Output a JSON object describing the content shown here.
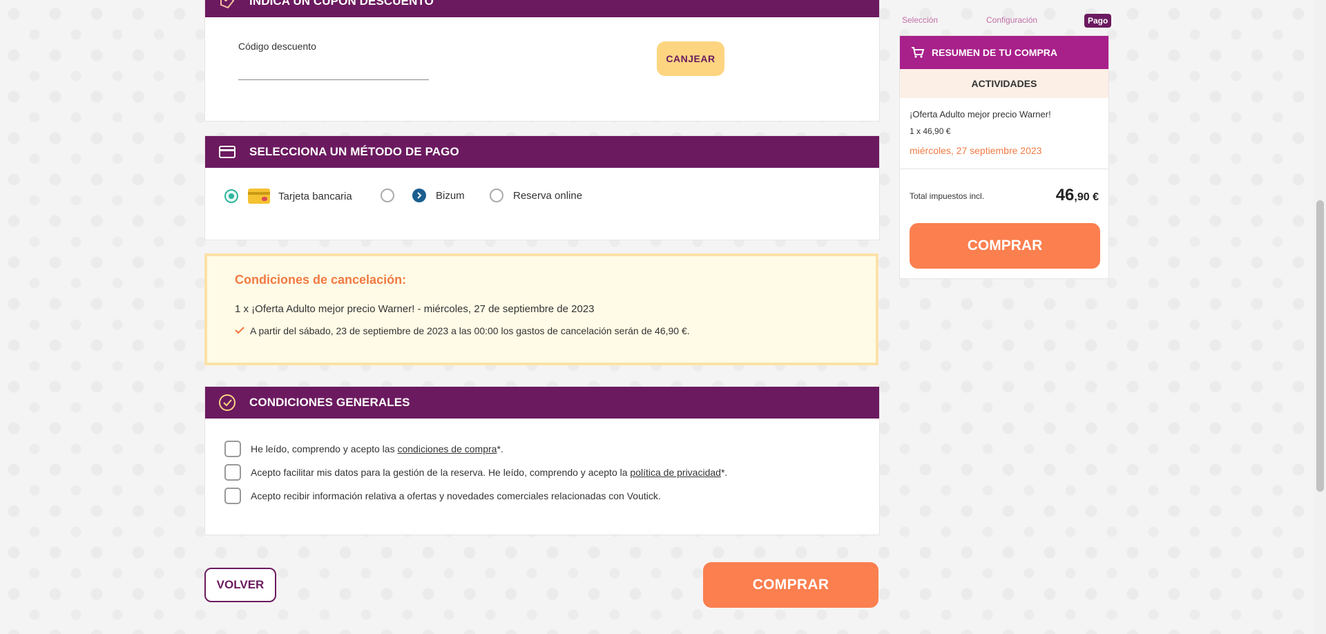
{
  "coupon": {
    "title": "INDICA UN CUPÓN DESCUENTO",
    "label": "Código descuento",
    "placeholder": "",
    "button": "CANJEAR"
  },
  "payment": {
    "title": "SELECCIONA UN MÉTODO DE PAGO",
    "options": [
      {
        "label": "Tarjeta bancaria",
        "selected": true
      },
      {
        "label": "Bizum",
        "selected": false
      },
      {
        "label": "Reserva online",
        "selected": false
      }
    ]
  },
  "cancellation": {
    "title": "Condiciones de cancelación:",
    "line1": "1 x ¡Oferta Adulto mejor precio Warner! - miércoles, 27 de septiembre de 2023",
    "line2": "A partir del sábado, 23 de septiembre de 2023 a las 00:00 los gastos de cancelación serán de 46,90 €."
  },
  "general": {
    "title": "CONDICIONES GENERALES",
    "cb1_pre": "He leído, comprendo y acepto las ",
    "cb1_link": "condiciones de compra",
    "cb1_post": "*.",
    "cb2_pre": "Acepto facilitar mis datos para la gestión de la reserva. He leído, comprendo y acepto la ",
    "cb2_link": "política de privacidad",
    "cb2_post": "*.",
    "cb3": "Acepto recibir información relativa a ofertas y novedades comerciales relacionadas con Voutick."
  },
  "actions": {
    "back": "VOLVER",
    "buy": "COMPRAR"
  },
  "steps": {
    "s1": "Selección",
    "s2": "Configuración",
    "s3": "Pago"
  },
  "summary": {
    "title": "RESUMEN DE TU COMPRA",
    "section": "ACTIVIDADES",
    "item_title": "¡Oferta Adulto mejor precio Warner!",
    "item_qty": "1 x 46,90 €",
    "item_date": "miércoles, 27 septiembre 2023",
    "total_label": "Total impuestos incl.",
    "total_int": "46",
    "total_dec": ",90 €",
    "buy": "COMPRAR"
  },
  "colors": {
    "primary": "#6b1a5f",
    "accent": "#fb7f4f",
    "summary_header": "#a8208a",
    "coupon_button": "#fdd580",
    "radio_selected": "#2fb59c"
  },
  "icons": {
    "coupon": "coupon-icon",
    "payment": "credit-card-icon",
    "general": "check-circle-icon",
    "cart": "cart-icon",
    "card": "card-icon",
    "bizum": "bizum-icon",
    "check": "check-icon"
  }
}
